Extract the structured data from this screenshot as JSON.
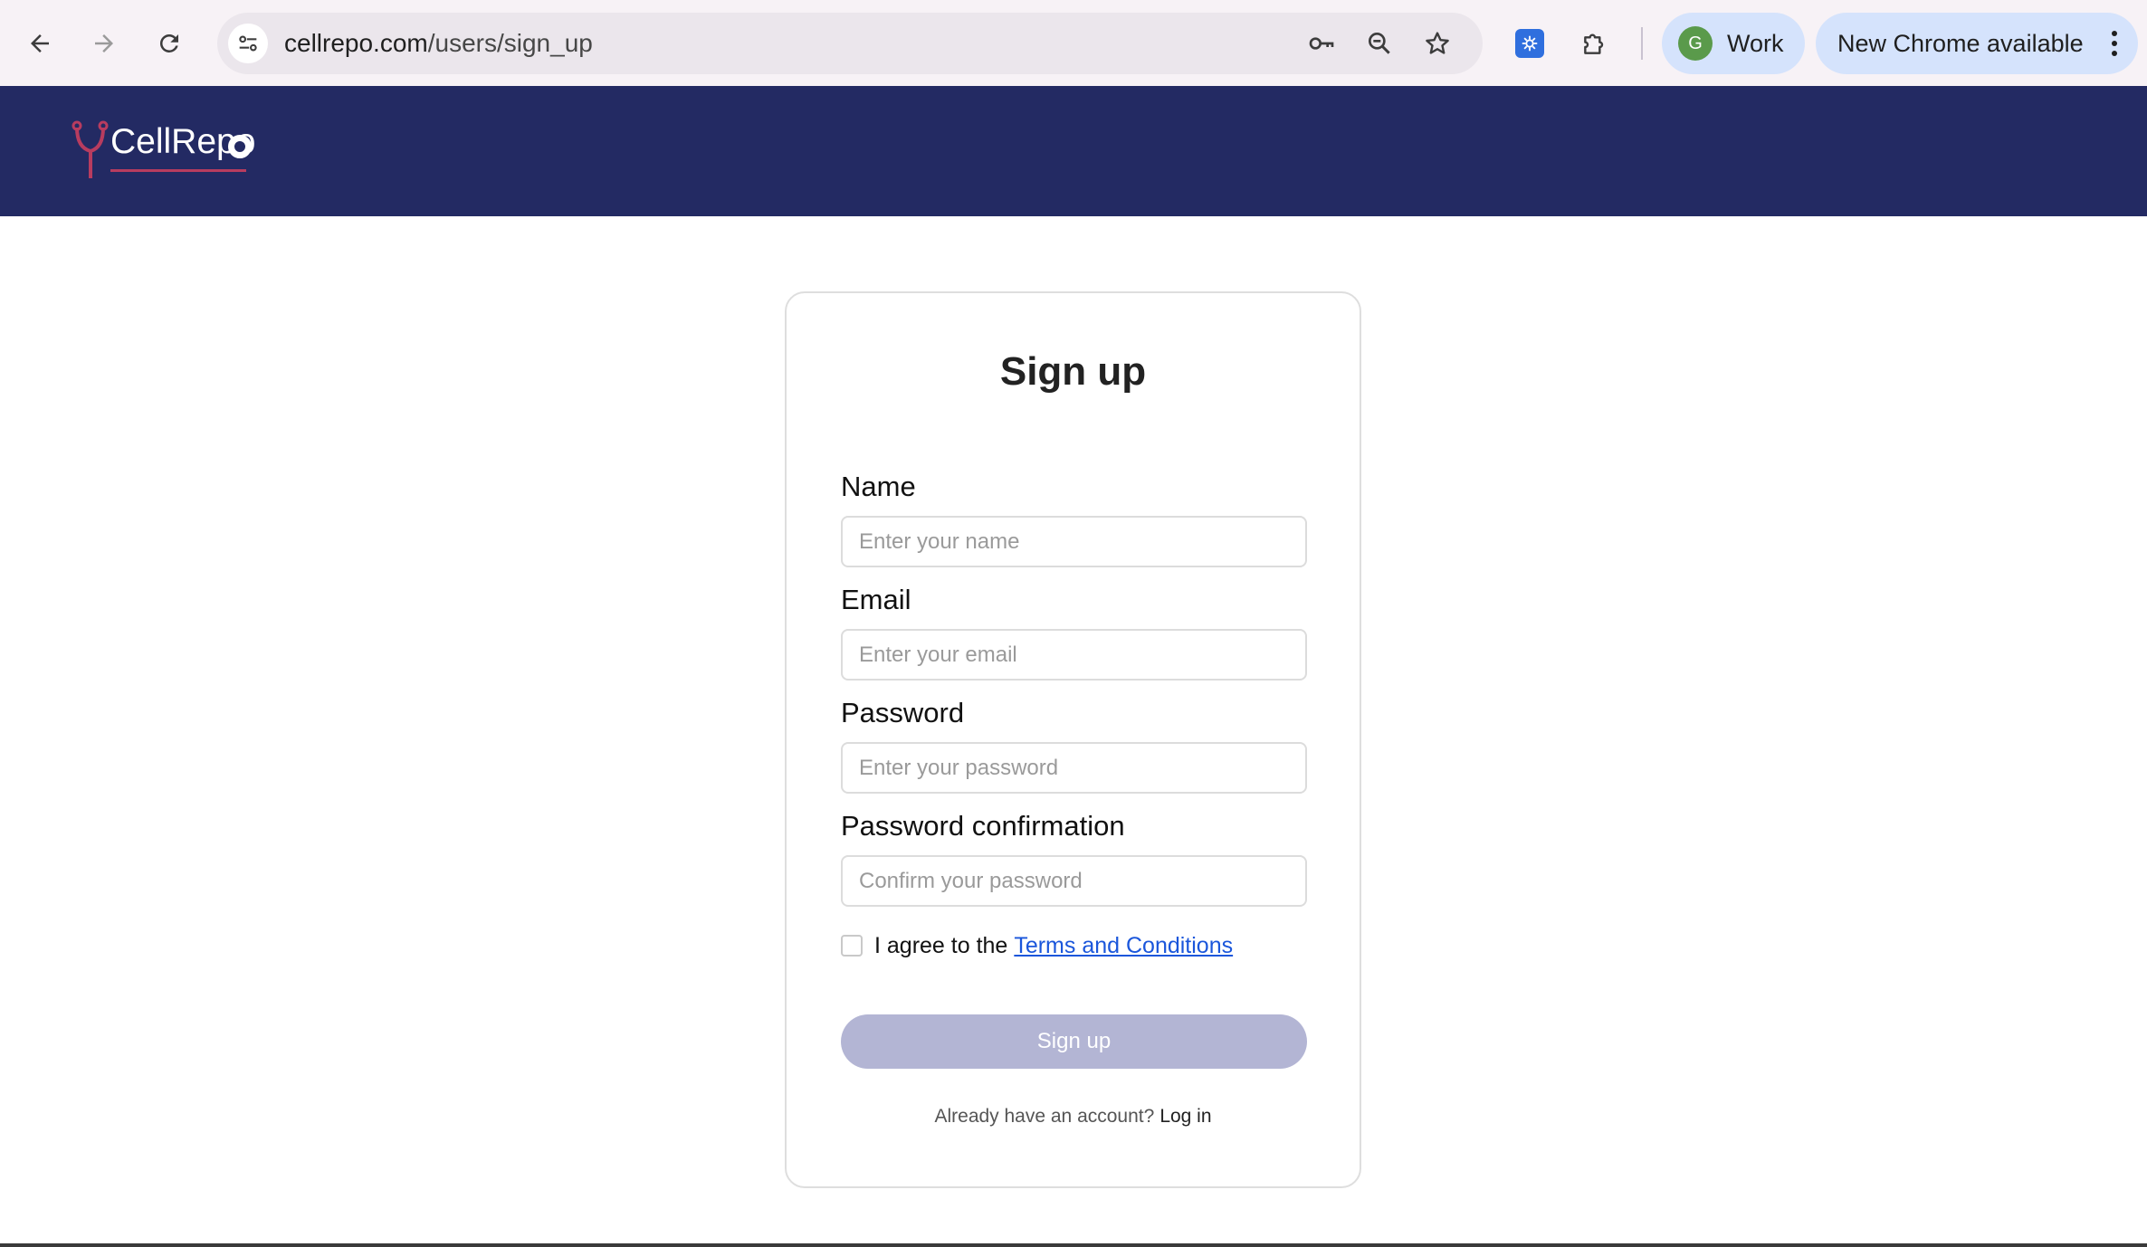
{
  "browser": {
    "url_host": "cellrepo.com",
    "url_path": "/users/sign_up",
    "profile_initial": "G",
    "profile_name": "Work",
    "update_label": "New Chrome available",
    "icons": [
      "back-arrow-icon",
      "forward-arrow-icon",
      "reload-icon",
      "site-settings-icon",
      "password-key-icon",
      "zoom-icon",
      "bookmark-star-icon",
      "extension-icon",
      "puzzle-extensions-icon",
      "more-menu-icon"
    ]
  },
  "site": {
    "logo_text": "CellRepo",
    "colors": {
      "header_bg": "#232a63",
      "logo_accent": "#b83c5f",
      "link": "#1a56db",
      "button_disabled": "#b3b5d4"
    }
  },
  "form": {
    "title": "Sign up",
    "name_label": "Name",
    "name_placeholder": "Enter your name",
    "email_label": "Email",
    "email_placeholder": "Enter your email",
    "password_label": "Password",
    "password_placeholder": "Enter your password",
    "confirm_label": "Password confirmation",
    "confirm_placeholder": "Confirm your password",
    "agree_text": "I agree to the",
    "terms_link": "Terms and Conditions",
    "submit_label": "Sign up",
    "login_prompt": "Already have an account?",
    "login_link": "Log in"
  }
}
